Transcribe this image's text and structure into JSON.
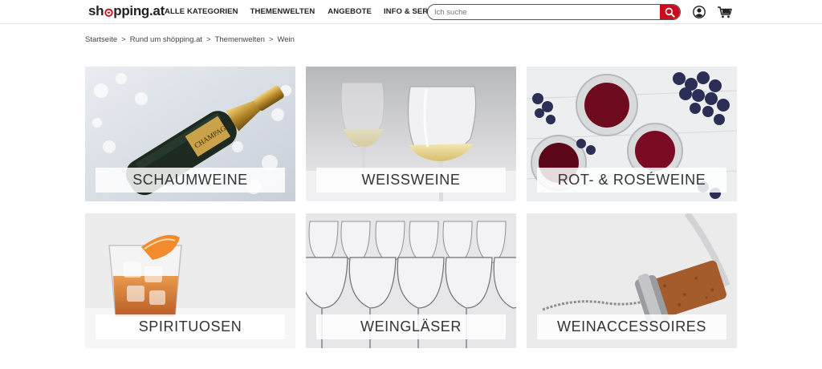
{
  "header": {
    "logo": {
      "pre": "sh",
      "post": "pping.at"
    },
    "nav": [
      {
        "label": "ALLE KATEGORIEN"
      },
      {
        "label": "THEMENWELTEN"
      },
      {
        "label": "ANGEBOTE"
      },
      {
        "label": "INFO & SERVICE"
      }
    ],
    "search": {
      "placeholder": "Ich suche",
      "value": ""
    },
    "icons": {
      "search": "search-icon",
      "user": "user-icon",
      "cart": "cart-icon"
    },
    "accent_color": "#cc0a1e"
  },
  "breadcrumb": {
    "items": [
      {
        "label": "Startseite"
      },
      {
        "label": "Rund um shöpping.at"
      },
      {
        "label": "Themenwelten"
      },
      {
        "label": "Wein"
      }
    ],
    "separator": ">"
  },
  "categories": [
    {
      "label": "SCHAUMWEINE"
    },
    {
      "label": "WEISSWEINE"
    },
    {
      "label": "ROT- & ROSÉWEINE"
    },
    {
      "label": "SPIRITUOSEN"
    },
    {
      "label": "WEINGLÄSER"
    },
    {
      "label": "WEINACCESSOIRES"
    }
  ]
}
